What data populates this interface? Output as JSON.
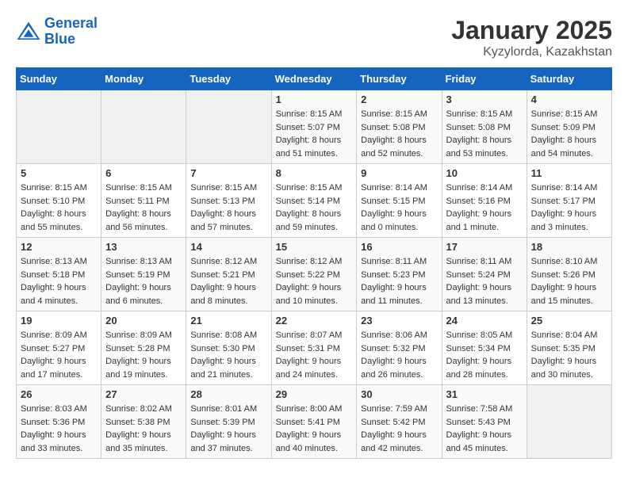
{
  "header": {
    "logo_line1": "General",
    "logo_line2": "Blue",
    "title": "January 2025",
    "subtitle": "Kyzylorda, Kazakhstan"
  },
  "weekdays": [
    "Sunday",
    "Monday",
    "Tuesday",
    "Wednesday",
    "Thursday",
    "Friday",
    "Saturday"
  ],
  "weeks": [
    [
      {
        "day": "",
        "sunrise": "",
        "sunset": "",
        "daylight": ""
      },
      {
        "day": "",
        "sunrise": "",
        "sunset": "",
        "daylight": ""
      },
      {
        "day": "",
        "sunrise": "",
        "sunset": "",
        "daylight": ""
      },
      {
        "day": "1",
        "sunrise": "8:15 AM",
        "sunset": "5:07 PM",
        "daylight": "8 hours and 51 minutes."
      },
      {
        "day": "2",
        "sunrise": "8:15 AM",
        "sunset": "5:08 PM",
        "daylight": "8 hours and 52 minutes."
      },
      {
        "day": "3",
        "sunrise": "8:15 AM",
        "sunset": "5:08 PM",
        "daylight": "8 hours and 53 minutes."
      },
      {
        "day": "4",
        "sunrise": "8:15 AM",
        "sunset": "5:09 PM",
        "daylight": "8 hours and 54 minutes."
      }
    ],
    [
      {
        "day": "5",
        "sunrise": "8:15 AM",
        "sunset": "5:10 PM",
        "daylight": "8 hours and 55 minutes."
      },
      {
        "day": "6",
        "sunrise": "8:15 AM",
        "sunset": "5:11 PM",
        "daylight": "8 hours and 56 minutes."
      },
      {
        "day": "7",
        "sunrise": "8:15 AM",
        "sunset": "5:13 PM",
        "daylight": "8 hours and 57 minutes."
      },
      {
        "day": "8",
        "sunrise": "8:15 AM",
        "sunset": "5:14 PM",
        "daylight": "8 hours and 59 minutes."
      },
      {
        "day": "9",
        "sunrise": "8:14 AM",
        "sunset": "5:15 PM",
        "daylight": "9 hours and 0 minutes."
      },
      {
        "day": "10",
        "sunrise": "8:14 AM",
        "sunset": "5:16 PM",
        "daylight": "9 hours and 1 minute."
      },
      {
        "day": "11",
        "sunrise": "8:14 AM",
        "sunset": "5:17 PM",
        "daylight": "9 hours and 3 minutes."
      }
    ],
    [
      {
        "day": "12",
        "sunrise": "8:13 AM",
        "sunset": "5:18 PM",
        "daylight": "9 hours and 4 minutes."
      },
      {
        "day": "13",
        "sunrise": "8:13 AM",
        "sunset": "5:19 PM",
        "daylight": "9 hours and 6 minutes."
      },
      {
        "day": "14",
        "sunrise": "8:12 AM",
        "sunset": "5:21 PM",
        "daylight": "9 hours and 8 minutes."
      },
      {
        "day": "15",
        "sunrise": "8:12 AM",
        "sunset": "5:22 PM",
        "daylight": "9 hours and 10 minutes."
      },
      {
        "day": "16",
        "sunrise": "8:11 AM",
        "sunset": "5:23 PM",
        "daylight": "9 hours and 11 minutes."
      },
      {
        "day": "17",
        "sunrise": "8:11 AM",
        "sunset": "5:24 PM",
        "daylight": "9 hours and 13 minutes."
      },
      {
        "day": "18",
        "sunrise": "8:10 AM",
        "sunset": "5:26 PM",
        "daylight": "9 hours and 15 minutes."
      }
    ],
    [
      {
        "day": "19",
        "sunrise": "8:09 AM",
        "sunset": "5:27 PM",
        "daylight": "9 hours and 17 minutes."
      },
      {
        "day": "20",
        "sunrise": "8:09 AM",
        "sunset": "5:28 PM",
        "daylight": "9 hours and 19 minutes."
      },
      {
        "day": "21",
        "sunrise": "8:08 AM",
        "sunset": "5:30 PM",
        "daylight": "9 hours and 21 minutes."
      },
      {
        "day": "22",
        "sunrise": "8:07 AM",
        "sunset": "5:31 PM",
        "daylight": "9 hours and 24 minutes."
      },
      {
        "day": "23",
        "sunrise": "8:06 AM",
        "sunset": "5:32 PM",
        "daylight": "9 hours and 26 minutes."
      },
      {
        "day": "24",
        "sunrise": "8:05 AM",
        "sunset": "5:34 PM",
        "daylight": "9 hours and 28 minutes."
      },
      {
        "day": "25",
        "sunrise": "8:04 AM",
        "sunset": "5:35 PM",
        "daylight": "9 hours and 30 minutes."
      }
    ],
    [
      {
        "day": "26",
        "sunrise": "8:03 AM",
        "sunset": "5:36 PM",
        "daylight": "9 hours and 33 minutes."
      },
      {
        "day": "27",
        "sunrise": "8:02 AM",
        "sunset": "5:38 PM",
        "daylight": "9 hours and 35 minutes."
      },
      {
        "day": "28",
        "sunrise": "8:01 AM",
        "sunset": "5:39 PM",
        "daylight": "9 hours and 37 minutes."
      },
      {
        "day": "29",
        "sunrise": "8:00 AM",
        "sunset": "5:41 PM",
        "daylight": "9 hours and 40 minutes."
      },
      {
        "day": "30",
        "sunrise": "7:59 AM",
        "sunset": "5:42 PM",
        "daylight": "9 hours and 42 minutes."
      },
      {
        "day": "31",
        "sunrise": "7:58 AM",
        "sunset": "5:43 PM",
        "daylight": "9 hours and 45 minutes."
      },
      {
        "day": "",
        "sunrise": "",
        "sunset": "",
        "daylight": ""
      }
    ]
  ]
}
